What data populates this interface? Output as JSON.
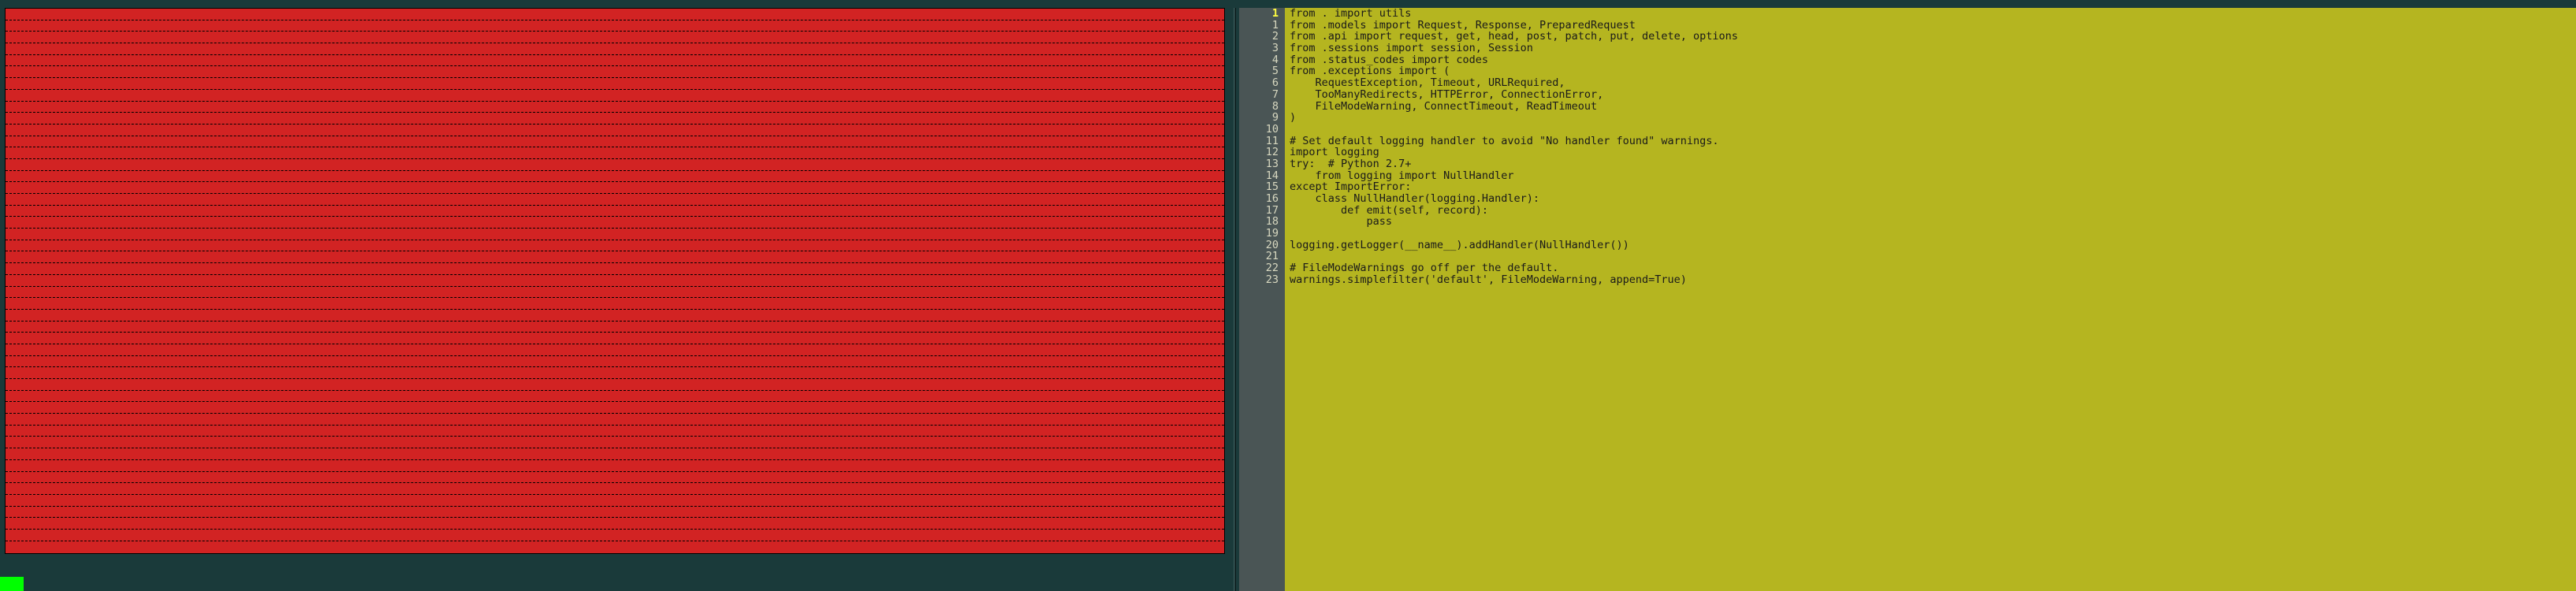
{
  "left_pane": {
    "type": "diff-deleted-block",
    "dash_rows": 47
  },
  "right_pane": {
    "current_line": 1,
    "lines": [
      {
        "n": 1,
        "text": "from . import utils",
        "rel": "cur"
      },
      {
        "n": 1,
        "text": "from .models import Request, Response, PreparedRequest"
      },
      {
        "n": 2,
        "text": "from .api import request, get, head, post, patch, put, delete, options"
      },
      {
        "n": 3,
        "text": "from .sessions import session, Session"
      },
      {
        "n": 4,
        "text": "from .status_codes import codes"
      },
      {
        "n": 5,
        "text": "from .exceptions import ("
      },
      {
        "n": 6,
        "text": "    RequestException, Timeout, URLRequired,"
      },
      {
        "n": 7,
        "text": "    TooManyRedirects, HTTPError, ConnectionError,"
      },
      {
        "n": 8,
        "text": "    FileModeWarning, ConnectTimeout, ReadTimeout"
      },
      {
        "n": 9,
        "text": ")"
      },
      {
        "n": 10,
        "text": ""
      },
      {
        "n": 11,
        "text": "# Set default logging handler to avoid \"No handler found\" warnings."
      },
      {
        "n": 12,
        "text": "import logging"
      },
      {
        "n": 13,
        "text": "try:  # Python 2.7+"
      },
      {
        "n": 14,
        "text": "    from logging import NullHandler"
      },
      {
        "n": 15,
        "text": "except ImportError:"
      },
      {
        "n": 16,
        "text": "    class NullHandler(logging.Handler):"
      },
      {
        "n": 17,
        "text": "        def emit(self, record):"
      },
      {
        "n": 18,
        "text": "            pass"
      },
      {
        "n": 19,
        "text": ""
      },
      {
        "n": 20,
        "text": "logging.getLogger(__name__).addHandler(NullHandler())"
      },
      {
        "n": 21,
        "text": ""
      },
      {
        "n": 22,
        "text": "# FileModeWarnings go off per the default."
      },
      {
        "n": 23,
        "text": "warnings.simplefilter('default', FileModeWarning, append=True)"
      }
    ]
  },
  "colors": {
    "deleted_bg": "#d22323",
    "code_bg": "#b5b520",
    "gutter_bg": "#4a5555",
    "frame_bg": "#1a3a3a"
  }
}
